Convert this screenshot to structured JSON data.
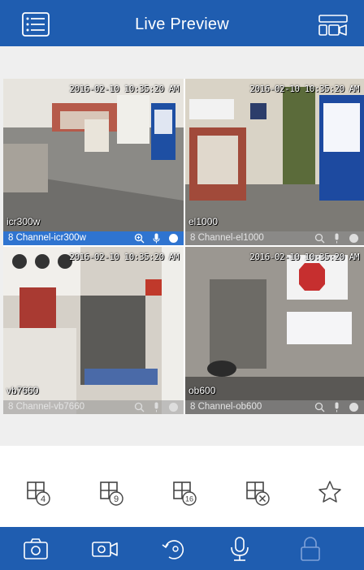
{
  "header": {
    "title": "Live Preview",
    "menu_icon": "list-menu-icon",
    "layout_icon": "camera-layout-icon"
  },
  "cameras": [
    {
      "name": "icr300w",
      "channel": "8 Channel-icr300w",
      "timestamp": "2016-02-10 10:35:20 AM",
      "selected": true
    },
    {
      "name": "el1000",
      "channel": "8 Channel-el1000",
      "timestamp": "2016-02-10 10:35:20 AM",
      "selected": false
    },
    {
      "name": "vb7660",
      "channel": "8 Channel-vb7660",
      "timestamp": "2016-02-10 10:35:20 AM",
      "selected": false
    },
    {
      "name": "ob600",
      "channel": "8 Channel-ob600",
      "timestamp": "2016-02-10 10:35:20 AM",
      "selected": false
    }
  ],
  "toolbar": [
    {
      "icon": "grid-4-icon",
      "label": "4"
    },
    {
      "icon": "grid-9-icon",
      "label": "9"
    },
    {
      "icon": "grid-16-icon",
      "label": "16"
    },
    {
      "icon": "grid-close-icon",
      "label": ""
    },
    {
      "icon": "star-icon",
      "label": ""
    }
  ],
  "bottom_bar": [
    {
      "icon": "camera-snapshot-icon"
    },
    {
      "icon": "video-record-icon"
    },
    {
      "icon": "ptz-rotate-icon"
    },
    {
      "icon": "microphone-icon"
    },
    {
      "icon": "lock-icon"
    }
  ],
  "colors": {
    "brand_blue": "#1f5db0",
    "selected_bar": "#2f74d0",
    "background_gray": "#efefef"
  }
}
